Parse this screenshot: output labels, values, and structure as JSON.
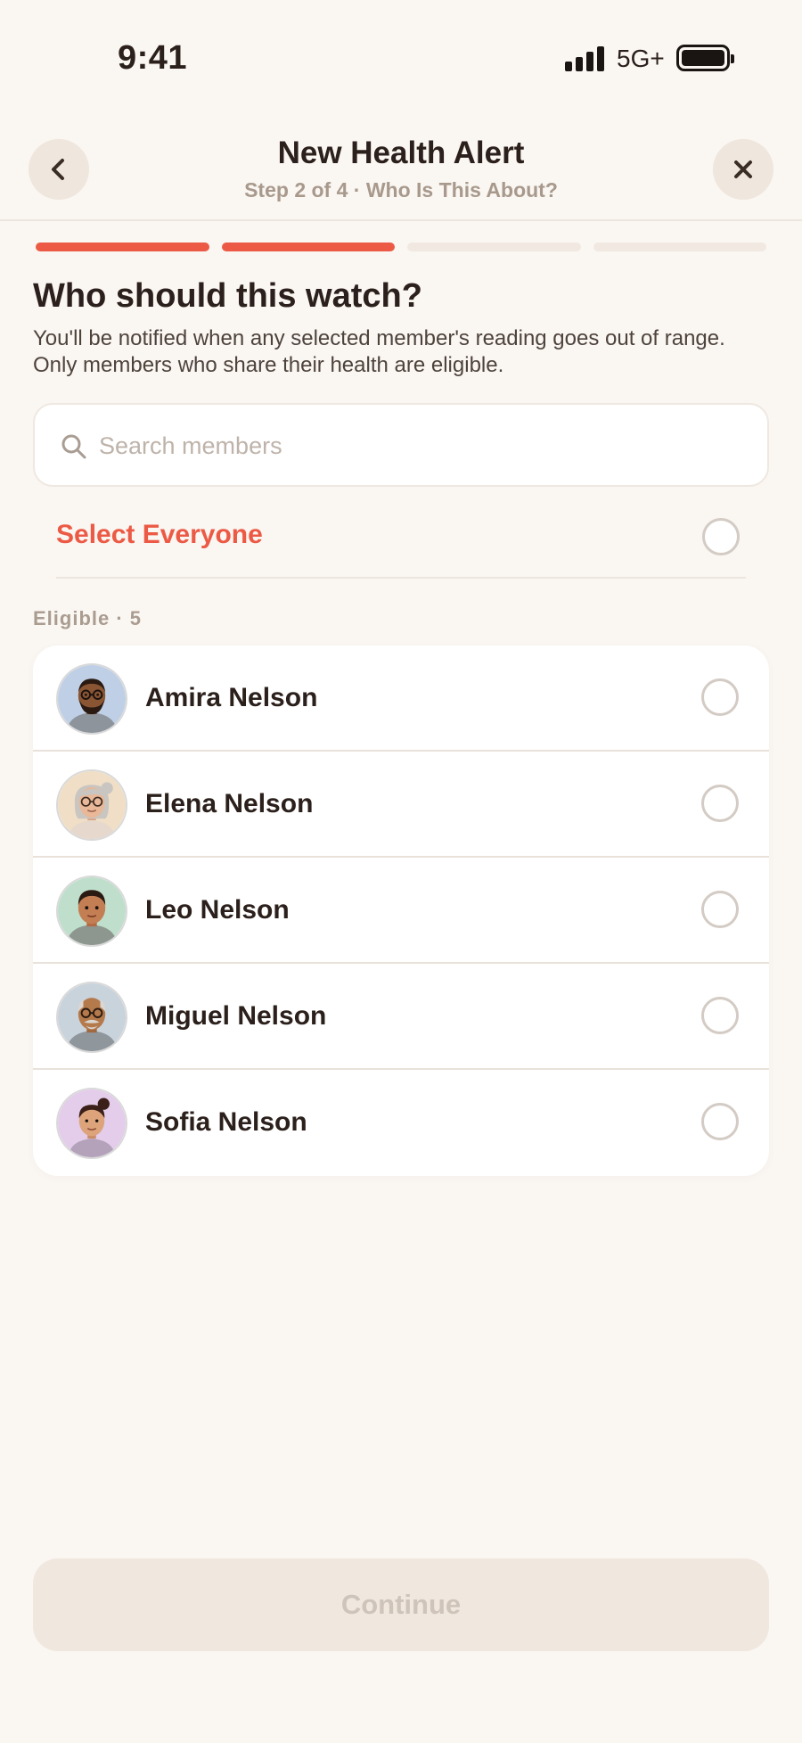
{
  "status_bar": {
    "time": "9:41",
    "network": "5G+"
  },
  "header": {
    "title": "New Health Alert",
    "subtitle": "Step 2 of 4 · Who Is This About?"
  },
  "progress": {
    "total_steps": 4,
    "current_step": 2
  },
  "main": {
    "heading": "Who should this watch?",
    "description": "You'll be notified when any selected member's reading goes out of range. Only members who share their health are eligible."
  },
  "search": {
    "placeholder": "Search members",
    "value": ""
  },
  "select_all": {
    "label": "Select Everyone",
    "selected": false
  },
  "section": {
    "label": "Eligible · 5"
  },
  "members": [
    {
      "name": "Amira Nelson",
      "avatar": "avatar-man-glasses-beard",
      "selected": false
    },
    {
      "name": "Elena Nelson",
      "avatar": "avatar-elderly-woman-glasses",
      "selected": false
    },
    {
      "name": "Leo Nelson",
      "avatar": "avatar-young-man",
      "selected": false
    },
    {
      "name": "Miguel Nelson",
      "avatar": "avatar-elderly-man-glasses-mustache",
      "selected": false
    },
    {
      "name": "Sofia Nelson",
      "avatar": "avatar-woman-bun",
      "selected": false
    }
  ],
  "footer": {
    "continue_label": "Continue",
    "enabled": false
  },
  "colors": {
    "accent": "#EC5A45",
    "background": "#FAF6F2",
    "disabled": "#F0E7DF"
  }
}
